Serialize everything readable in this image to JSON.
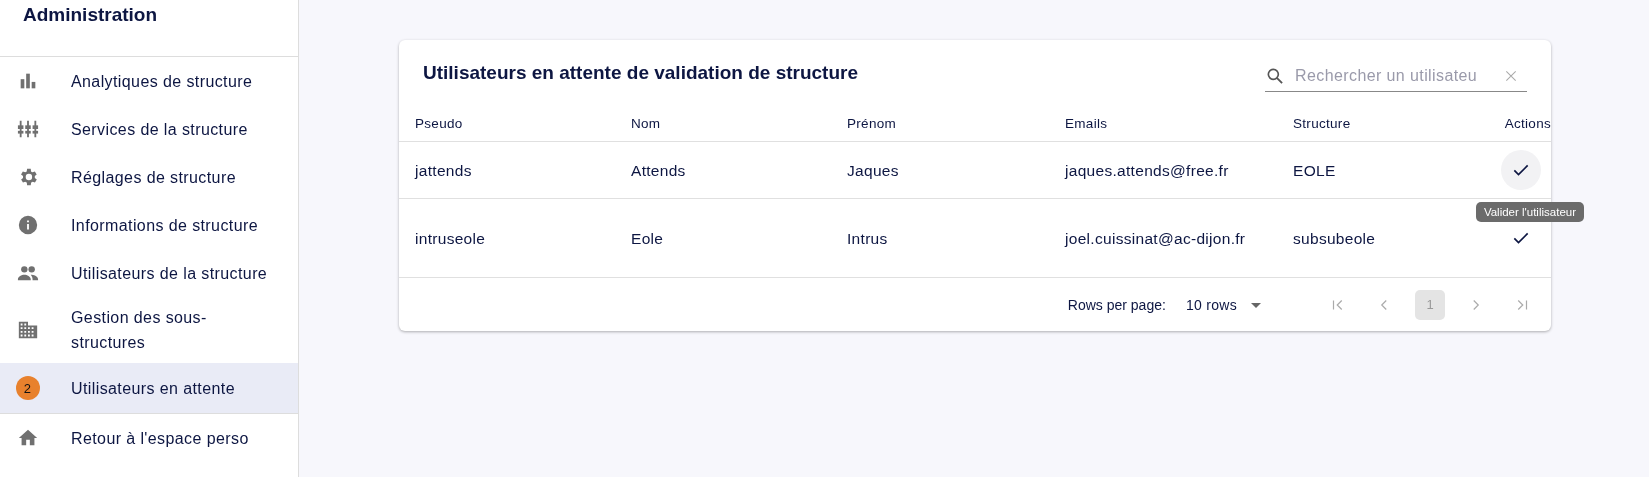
{
  "sidebar": {
    "title": "Administration",
    "items": [
      {
        "label": "Analytiques de structure",
        "selected": false
      },
      {
        "label": "Services de la structure",
        "selected": false
      },
      {
        "label": "Réglages de structure",
        "selected": false
      },
      {
        "label": "Informations de structure",
        "selected": false
      },
      {
        "label": "Utilisateurs de la structure",
        "selected": false
      },
      {
        "label": "Gestion des sous-structures",
        "selected": false
      },
      {
        "badge": "2",
        "label": "Utilisateurs en attente",
        "selected": true
      },
      {
        "label": "Retour à l'espace perso",
        "selected": false
      }
    ]
  },
  "card": {
    "title": "Utilisateurs en attente de validation de structure",
    "search": {
      "placeholder": "Rechercher un utilisateu"
    },
    "table": {
      "columns": [
        "Pseudo",
        "Nom",
        "Prénom",
        "Emails",
        "Structure",
        "Actions"
      ],
      "rows": [
        {
          "cells": [
            "jattends",
            "Attends",
            "Jaques",
            "jaques.attends@free.fr",
            "EOLE"
          ],
          "action_hovered": true
        },
        {
          "cells": [
            "intruseole",
            "Eole",
            "Intrus",
            "joel.cuissinat@ac-dijon.fr",
            "subsubeole"
          ],
          "action_hovered": false
        }
      ]
    },
    "tooltip": "Valider l'utilisateur",
    "pagination": {
      "rows_label": "Rows per page:",
      "rows_value": "10 rows",
      "page": "1",
      "buttons": [
        {
          "kind": "first",
          "disabled": true
        },
        {
          "kind": "prev",
          "disabled": true
        },
        {
          "kind": "page"
        },
        {
          "kind": "next",
          "disabled": true
        },
        {
          "kind": "last",
          "disabled": true
        }
      ]
    }
  }
}
